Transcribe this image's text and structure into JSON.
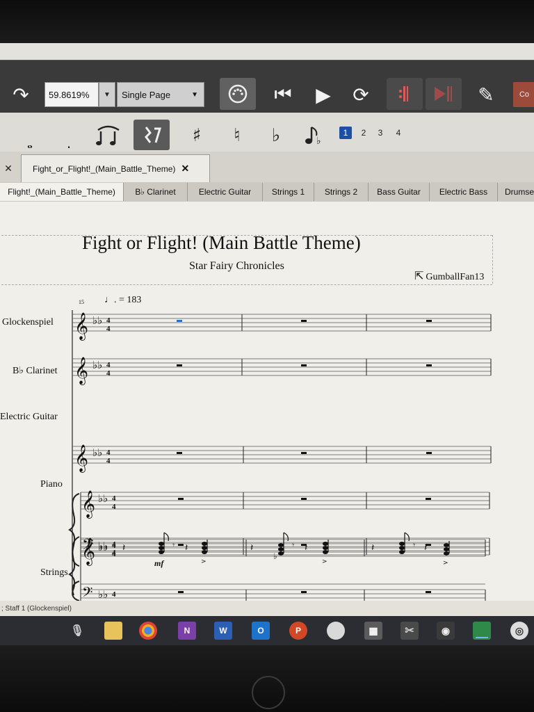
{
  "toolbar": {
    "zoom_value": "59.8619%",
    "view_mode": "Single Page",
    "voices": [
      "1",
      "2",
      "3",
      "4"
    ],
    "cut_label": "Co"
  },
  "document": {
    "tab_title": "Fight_or_Flight!_(Main_Battle_Theme)",
    "close_symbol": "✕"
  },
  "part_tabs": [
    "Flight!_(Main_Battle_Theme)",
    "B♭ Clarinet",
    "Electric Guitar",
    "Strings 1",
    "Strings 2",
    "Bass Guitar",
    "Electric Bass",
    "Drumse"
  ],
  "score": {
    "title": "Fight or Flight! (Main Battle Theme)",
    "subtitle": "Star Fairy Chronicles",
    "composer": "GumballFan13",
    "tempo": "♩. = 183",
    "measure_number": "15",
    "dynamic": "mf",
    "instruments": {
      "glockenspiel": "Glockenspiel",
      "clarinet": "B♭ Clarinet",
      "guitar": "Electric Guitar",
      "piano": "Piano",
      "strings": "Strings"
    }
  },
  "status": {
    "text": "; Staff 1 (Glockenspiel)"
  },
  "taskbar": {
    "onenote_label": "N",
    "word_label": "W",
    "outlook_label": "O",
    "powerpoint_label": "P"
  },
  "colors": {
    "toolbar_bg": "#3a3a3b",
    "selection_blue": "#1d4fa5",
    "taskbar_bg": "#2b2d33"
  }
}
